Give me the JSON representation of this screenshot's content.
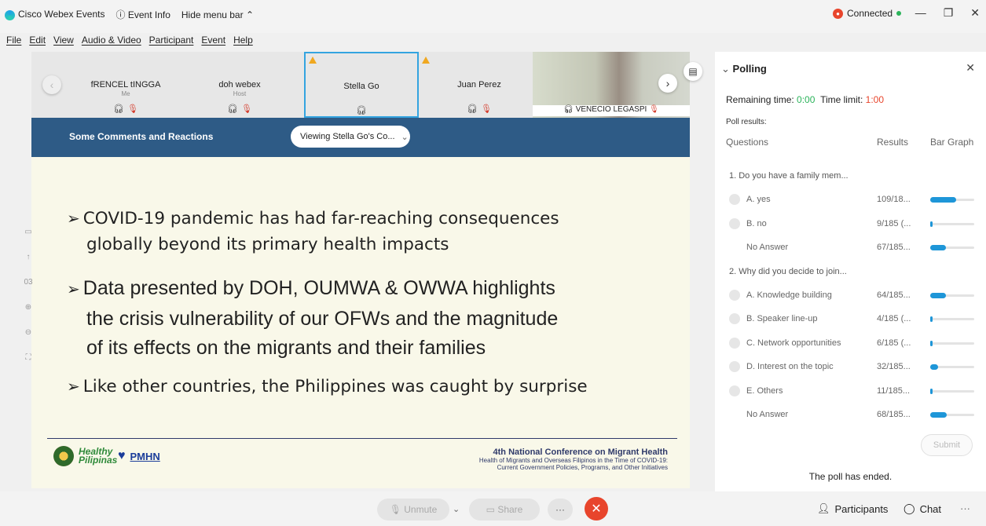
{
  "titlebar": {
    "app_name": "Cisco Webex Events",
    "event_info": "Event Info",
    "hide_menu": "Hide menu bar",
    "connected": "Connected"
  },
  "menu": [
    "File",
    "Edit",
    "View",
    "Audio & Video",
    "Participant",
    "Event",
    "Help"
  ],
  "participants_strip": [
    {
      "name": "fRENCEL tINGGA",
      "role": "Me"
    },
    {
      "name": "doh webex",
      "role": "Host"
    },
    {
      "name": "Stella Go",
      "role": ""
    },
    {
      "name": "Juan Perez",
      "role": ""
    },
    {
      "name": "VENECIO LEGASPI",
      "role": ""
    }
  ],
  "slide": {
    "header": "Some Comments and Reactions",
    "viewing": "Viewing Stella Go's Co...",
    "bullets": [
      [
        "COVID-19 pandemic has had far-reaching consequences",
        "globally beyond its primary health impacts"
      ],
      [
        "Data presented by DOH, OUMWA & OWWA highlights",
        "the crisis vulnerability of our OFWs and the magnitude",
        "of its effects on the migrants and their families"
      ],
      [
        "Like other countries, the Philippines was caught by surprise"
      ]
    ],
    "logo_text_1": "Healthy Pilipinas",
    "logo_text_2": "PMHN",
    "conf_title": "4th National Conference on Migrant Health",
    "conf_sub1": "Health of Migrants and Overseas Filipinos in the Time of COVID-19:",
    "conf_sub2": "Current Government Policies, Programs, and Other Initiatives",
    "page_num": "03"
  },
  "polling": {
    "title": "Polling",
    "remaining_label": "Remaining time:",
    "remaining_value": "0:00",
    "limit_label": "Time limit:",
    "limit_value": "1:00",
    "poll_results": "Poll results:",
    "col_questions": "Questions",
    "col_results": "Results",
    "col_bar": "Bar Graph",
    "questions": [
      {
        "q": "1. Do you have a family mem...",
        "answers": [
          {
            "label": "A.  yes",
            "result": "109/18...",
            "fraction": 0.59,
            "radio": true
          },
          {
            "label": "B.  no",
            "result": "9/185 (...",
            "fraction": 0.05,
            "radio": true
          },
          {
            "label": "No Answer",
            "result": "67/185...",
            "fraction": 0.36,
            "radio": false
          }
        ]
      },
      {
        "q": "2. Why did you decide to join...",
        "answers": [
          {
            "label": "A.  Knowledge building",
            "result": "64/185...",
            "fraction": 0.35,
            "radio": true
          },
          {
            "label": "B.  Speaker line-up",
            "result": "4/185 (...",
            "fraction": 0.02,
            "radio": true
          },
          {
            "label": "C.  Network opportunities",
            "result": "6/185 (...",
            "fraction": 0.03,
            "radio": true
          },
          {
            "label": "D.  Interest on the topic",
            "result": "32/185...",
            "fraction": 0.17,
            "radio": true
          },
          {
            "label": "E.  Others",
            "result": "11/185...",
            "fraction": 0.06,
            "radio": true
          },
          {
            "label": "No Answer",
            "result": "68/185...",
            "fraction": 0.37,
            "radio": false
          }
        ]
      }
    ],
    "submit": "Submit",
    "ended": "The poll has ended."
  },
  "bottombar": {
    "unmute": "Unmute",
    "share": "Share",
    "participants": "Participants",
    "chat": "Chat"
  }
}
